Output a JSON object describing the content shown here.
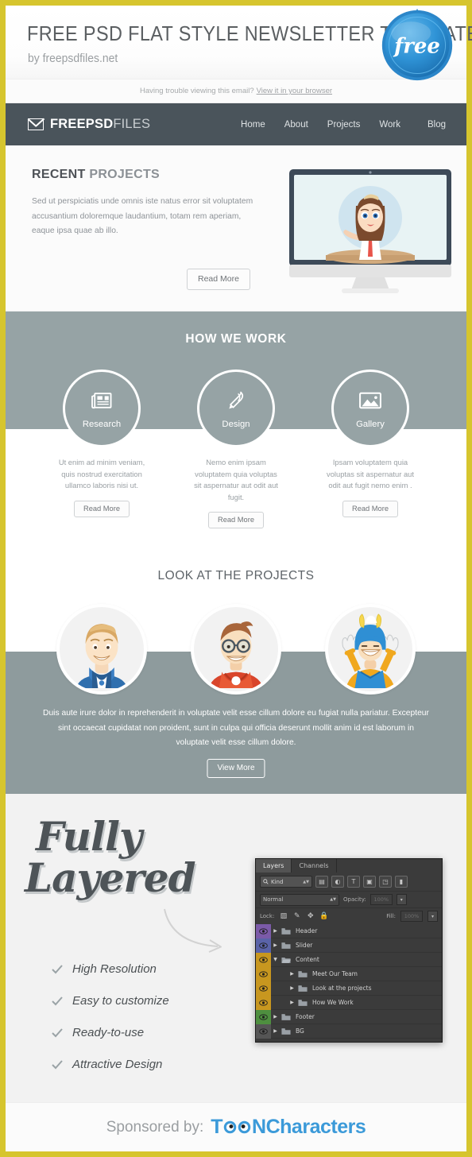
{
  "banner": {
    "title": "FREE PSD FLAT STYLE NEWSLETTER TEMPLATE",
    "subtitle": "by freepsdfiles.net",
    "badge_text": "free",
    "badge_color": "#2e8fd4",
    "border_color": "#d6c52e"
  },
  "trouble": {
    "text": "Having trouble viewing this email?",
    "link": "View it in your browser"
  },
  "nav": {
    "logo_bold": "FREEPSD",
    "logo_light": "FILES",
    "logo_icon": "envelope-icon",
    "bar_color": "#4a545b",
    "items": [
      {
        "label": "Home"
      },
      {
        "label": "About"
      },
      {
        "label": "Projects"
      },
      {
        "label": "Work"
      },
      {
        "label": "Blog"
      }
    ]
  },
  "recent": {
    "title_strong": "RECENT",
    "title_light": "PROJECTS",
    "body": "Sed ut perspiciatis unde omnis iste natus error sit voluptatem accusantium doloremque laudantium, totam rem aperiam, eaque ipsa quae ab illo.",
    "button": "Read More",
    "illustration": "desktop-monitor-girl-illustration"
  },
  "how_we_work": {
    "title": "HOW WE WORK",
    "band_color": "#96a3a5",
    "items": [
      {
        "label": "Research",
        "icon": "newspaper-icon",
        "desc": "Ut enim ad minim veniam, quis nostrud exercitation ullamco laboris nisi ut.",
        "button": "Read More"
      },
      {
        "label": "Design",
        "icon": "quill-pen-icon",
        "desc": "Nemo enim ipsam voluptatem quia voluptas sit aspernatur aut odit aut fugit.",
        "button": "Read More"
      },
      {
        "label": "Gallery",
        "icon": "image-photo-icon",
        "desc": "Ipsam voluptatem quia voluptas sit aspernatur aut odit aut fugit nemo enim .",
        "button": "Read More"
      }
    ]
  },
  "look_at_projects": {
    "title": "LOOK AT THE PROJECTS",
    "band_color": "#8e9b9d",
    "avatars": [
      {
        "name": "blue-superhero-avatar"
      },
      {
        "name": "red-superhero-glasses-avatar"
      },
      {
        "name": "blue-yellow-cheering-hero-avatar"
      }
    ],
    "body": "Duis aute irure dolor in reprehenderit in voluptate velit esse cillum dolore eu fugiat nulla pariatur. Excepteur sint occaecat cupidatat non proident, sunt in culpa qui officia deserunt mollit anim id est laborum  in voluptate velit esse cillum dolore.",
    "button": "View More"
  },
  "fully_layered": {
    "script_line1": "Fully",
    "script_line2": "Layered",
    "features": [
      {
        "label": "High Resolution"
      },
      {
        "label": "Easy to customize"
      },
      {
        "label": "Ready-to-use"
      },
      {
        "label": "Attractive Design"
      }
    ]
  },
  "photoshop_panel": {
    "tabs": [
      {
        "label": "Layers",
        "active": true
      },
      {
        "label": "Channels",
        "active": false
      }
    ],
    "filter": {
      "kind_label": "Kind",
      "icons": [
        "pixel-layer-filter-icon",
        "adjustment-layer-filter-icon",
        "type-layer-filter-icon",
        "shape-layer-filter-icon",
        "smart-object-filter-icon",
        "filter-toggle-icon"
      ]
    },
    "blend_mode": "Normal",
    "opacity_label": "Opacity:",
    "opacity_value": "100%",
    "lock_label": "Lock:",
    "lock_icons": [
      "lock-transparent-pixels-icon",
      "lock-image-pixels-icon",
      "lock-position-icon",
      "lock-all-icon"
    ],
    "fill_label": "Fill:",
    "fill_value": "100%",
    "layers": [
      {
        "name": "Header",
        "color": "#7b5aa8",
        "indent": 0,
        "expanded": false
      },
      {
        "name": "Slider",
        "color": "#5a63a8",
        "indent": 0,
        "expanded": false
      },
      {
        "name": "Content",
        "color": "#c8971f",
        "indent": 0,
        "expanded": true
      },
      {
        "name": "Meet Our Team",
        "color": "#c8971f",
        "indent": 1,
        "expanded": false
      },
      {
        "name": "Look at the projects",
        "color": "#c8971f",
        "indent": 1,
        "expanded": false
      },
      {
        "name": "How We Work",
        "color": "#c8971f",
        "indent": 1,
        "expanded": false
      },
      {
        "name": "Footer",
        "color": "#4e8f3f",
        "indent": 0,
        "expanded": false
      },
      {
        "name": "BG",
        "color": "#555555",
        "indent": 0,
        "expanded": false
      }
    ]
  },
  "footer": {
    "sponsored_label": "Sponsored by:",
    "sponsor_part1": "T",
    "sponsor_part2": "N",
    "sponsor_part3": "Characters",
    "sponsor_color": "#3b9ad9"
  }
}
